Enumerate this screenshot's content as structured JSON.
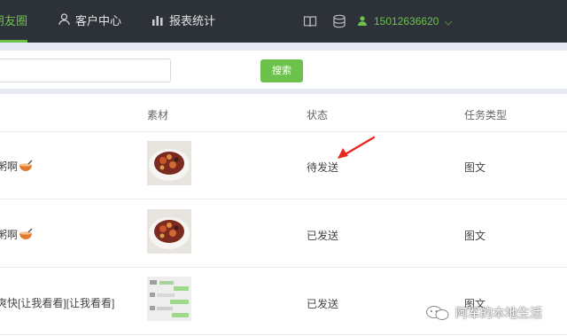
{
  "nav": {
    "items": [
      {
        "label": "朋友圈",
        "active": true
      },
      {
        "label": "客户中心",
        "icon": "person-icon"
      },
      {
        "label": "报表统计",
        "icon": "bar-chart-icon"
      }
    ],
    "tools": [
      "book-icon",
      "database-icon"
    ],
    "user_phone": "15012636620"
  },
  "search": {
    "value": "",
    "button_label": "搜索"
  },
  "table": {
    "headers": [
      "素材",
      "状态",
      "任务类型"
    ],
    "rows": [
      {
        "content": "粥啊",
        "content_icon": "soup-bowl-emoji",
        "thumbnail": "food-bowl-image",
        "status": "待发送",
        "task_type": "图文"
      },
      {
        "content": "粥啊",
        "content_icon": "soup-bowl-emoji",
        "thumbnail": "food-bowl-image",
        "status": "已发送",
        "task_type": "图文"
      },
      {
        "content": "爽快[让我看看][让我看看]",
        "thumbnail": "chat-screenshot-image",
        "status": "已发送",
        "task_type": "图文"
      }
    ]
  },
  "watermark": {
    "text": "阿军的本地生活"
  },
  "colors": {
    "accent": "#6cc24a",
    "nav_bg": "#2d3239",
    "arrow": "#e8281f"
  }
}
